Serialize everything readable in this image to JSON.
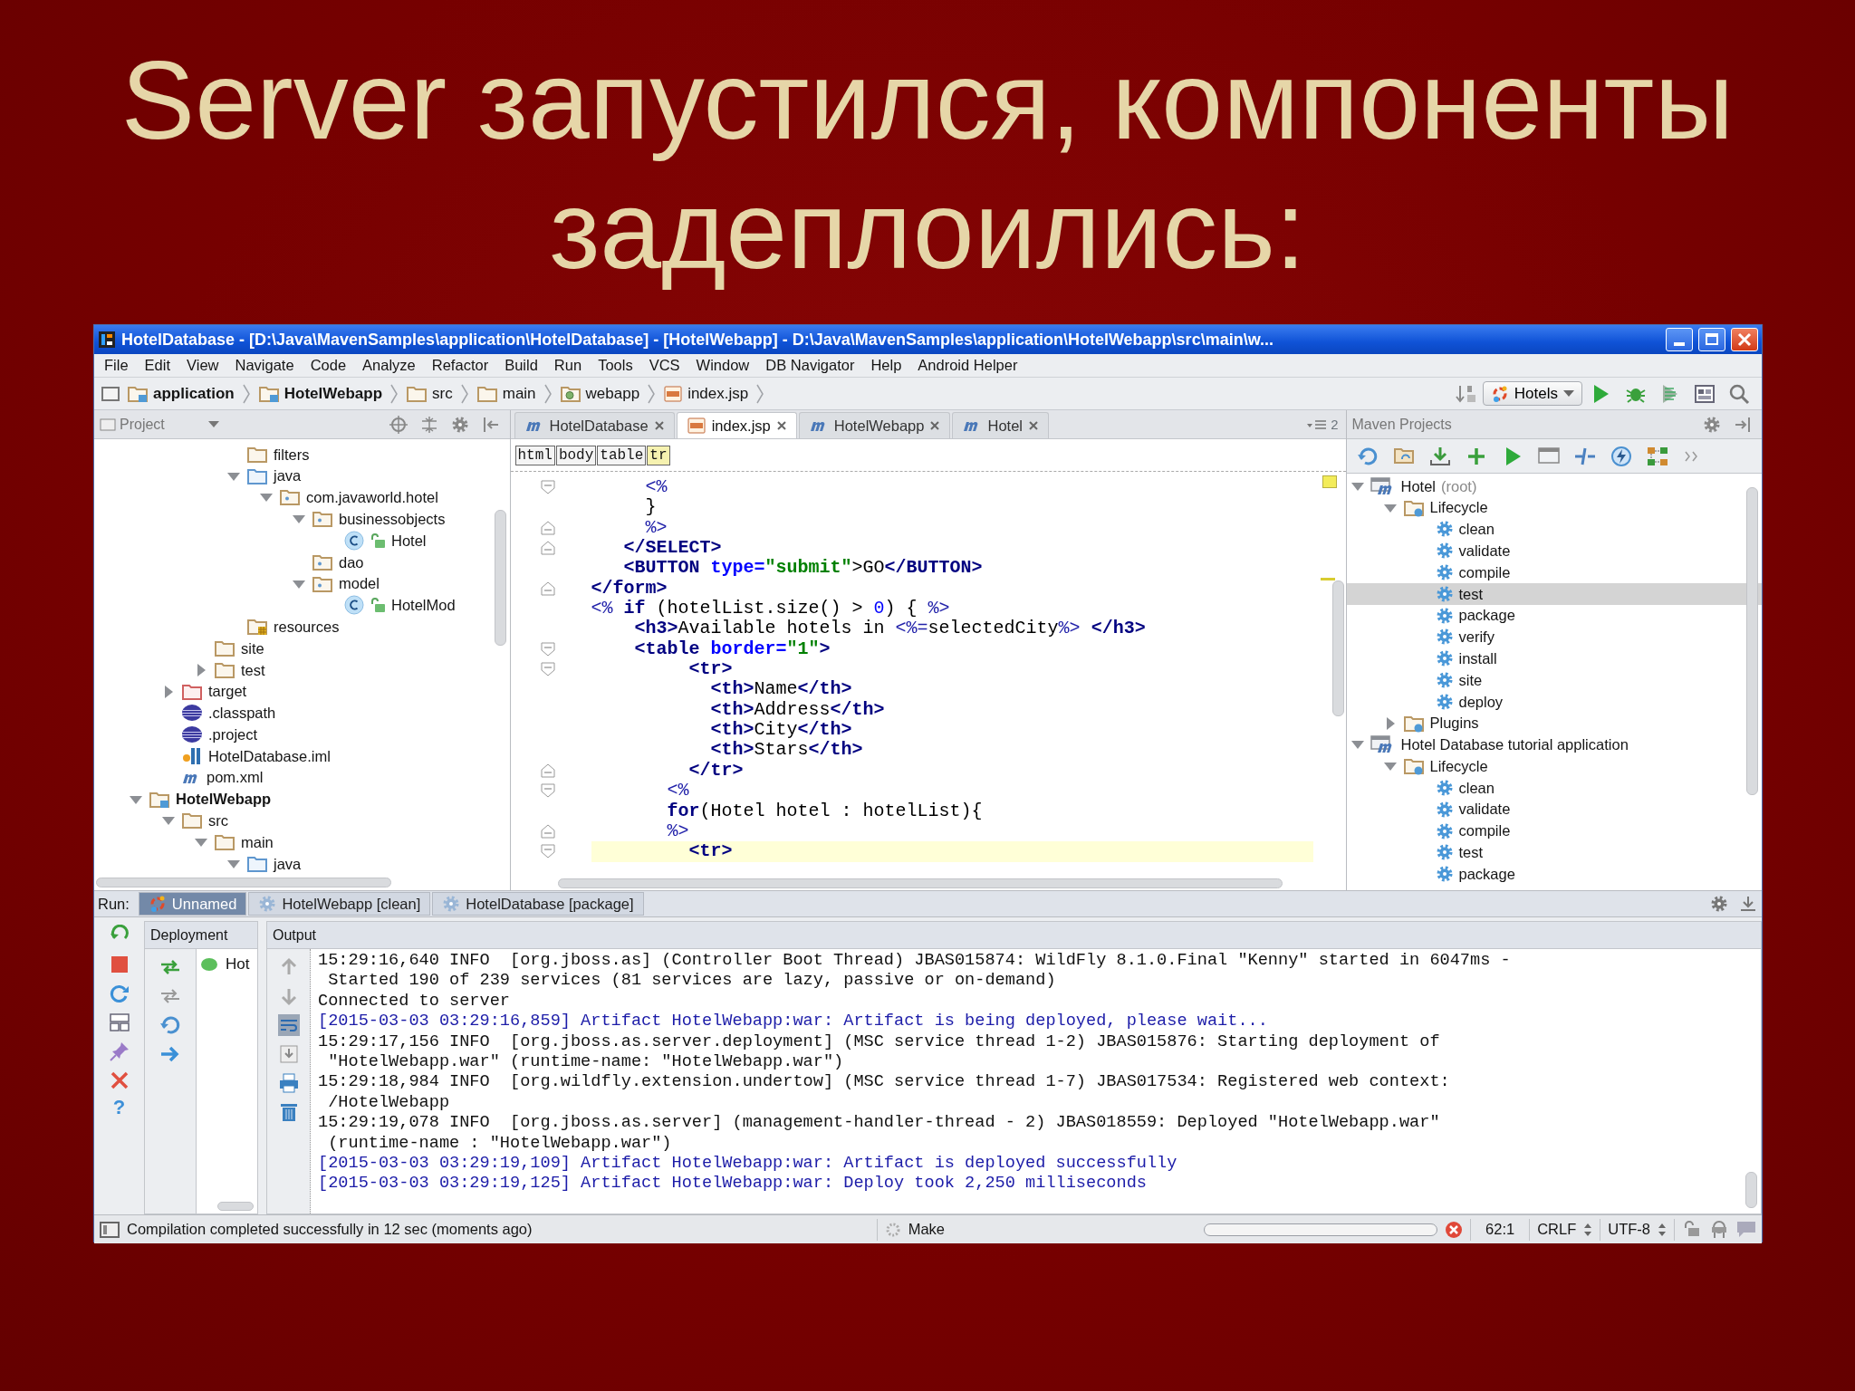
{
  "slide_title": "Server запустился, компоненты задеплоились:",
  "window": {
    "title": "HotelDatabase - [D:\\Java\\MavenSamples\\application\\HotelDatabase] - [HotelWebapp] - D:\\Java\\MavenSamples\\application\\HotelWebapp\\src\\main\\w..."
  },
  "menu": [
    "File",
    "Edit",
    "View",
    "Navigate",
    "Code",
    "Analyze",
    "Refactor",
    "Build",
    "Run",
    "Tools",
    "VCS",
    "Window",
    "DB Navigator",
    "Help",
    "Android Helper"
  ],
  "breadcrumbs": [
    {
      "label": "application",
      "kind": "module"
    },
    {
      "label": "HotelWebapp",
      "kind": "module"
    },
    {
      "label": "src",
      "kind": "folder"
    },
    {
      "label": "main",
      "kind": "folder"
    },
    {
      "label": "webapp",
      "kind": "web"
    },
    {
      "label": "index.jsp",
      "kind": "jsp"
    }
  ],
  "run_configuration": "Hotels",
  "project_panel": {
    "title": "Project",
    "tree": [
      {
        "children": [
          {
            "children": [
              {
                "children": [
                  {
                    "label": "filters",
                    "kind": "folder"
                  },
                  {
                    "label": "java",
                    "kind": "source",
                    "expanded": true,
                    "children": [
                      {
                        "label": "com.javaworld.hotel",
                        "kind": "package",
                        "expanded": true,
                        "children": [
                          {
                            "label": "businessobjects",
                            "kind": "package",
                            "expanded": true,
                            "children": [
                              {
                                "label": "Hotel",
                                "kind": "class"
                              }
                            ]
                          },
                          {
                            "label": "dao",
                            "kind": "package"
                          },
                          {
                            "label": "model",
                            "kind": "package",
                            "expanded": true,
                            "children": [
                              {
                                "label": "HotelMod",
                                "kind": "class"
                              }
                            ]
                          }
                        ]
                      }
                    ]
                  },
                  {
                    "label": "resources",
                    "kind": "resources"
                  }
                ]
              },
              {
                "label": "site",
                "kind": "folder"
              },
              {
                "label": "test",
                "kind": "folder",
                "expanded": false
              }
            ]
          },
          {
            "label": "target",
            "kind": "excluded",
            "expanded": false
          },
          {
            "label": ".classpath",
            "kind": "eclipse"
          },
          {
            "label": ".project",
            "kind": "eclipse"
          },
          {
            "label": "HotelDatabase.iml",
            "kind": "iml"
          },
          {
            "label": "pom.xml",
            "kind": "maven"
          }
        ]
      },
      {
        "label": "HotelWebapp",
        "kind": "module",
        "expanded": true,
        "children": [
          {
            "label": "src",
            "kind": "folder",
            "expanded": true,
            "children": [
              {
                "label": "main",
                "kind": "folder",
                "expanded": true,
                "children": [
                  {
                    "label": "java",
                    "kind": "source",
                    "expanded": true
                  }
                ]
              }
            ]
          }
        ]
      }
    ]
  },
  "editor": {
    "tabs": [
      {
        "label": "HotelDatabase",
        "kind": "maven",
        "selected": false
      },
      {
        "label": "index.jsp",
        "kind": "jsp",
        "selected": true
      },
      {
        "label": "HotelWebapp",
        "kind": "maven",
        "selected": false
      },
      {
        "label": "Hotel",
        "kind": "maven",
        "selected": false
      }
    ],
    "hidden_tab_count": "2",
    "tag_path": [
      {
        "label": "html",
        "selected": false
      },
      {
        "label": "body",
        "selected": false
      },
      {
        "label": "table",
        "selected": false
      },
      {
        "label": "tr",
        "selected": true
      }
    ],
    "lines": [
      {
        "kind": "fold_start",
        "current": false,
        "tokens": [
          {
            "text": "     <%",
            "kind": "jsp"
          }
        ]
      },
      {
        "kind": "plain",
        "current": false,
        "tokens": [
          {
            "text": "     }",
            "kind": "text"
          }
        ]
      },
      {
        "kind": "fold_end",
        "current": false,
        "tokens": [
          {
            "text": "     %>",
            "kind": "jsp"
          }
        ]
      },
      {
        "kind": "fold_end",
        "current": false,
        "tokens": [
          {
            "text": "   </SELECT>",
            "kind": "tag"
          }
        ]
      },
      {
        "kind": "plain",
        "current": false,
        "tokens": [
          {
            "text": "   <BUTTON",
            "kind": "tag"
          },
          {
            "text": " type=",
            "kind": "attr"
          },
          {
            "text": "\"submit\"",
            "kind": "str"
          },
          {
            "text": ">GO",
            "kind": "text"
          },
          {
            "text": "</BUTTON>",
            "kind": "tag"
          }
        ]
      },
      {
        "kind": "fold_end",
        "current": false,
        "tokens": [
          {
            "text": "</form>",
            "kind": "tag"
          }
        ]
      },
      {
        "kind": "plain",
        "current": false,
        "tokens": [
          {
            "text": "<%",
            "kind": "jsp"
          },
          {
            "text": " if",
            "kind": "kw"
          },
          {
            "text": " (hotelList.size() > ",
            "kind": "text"
          },
          {
            "text": "0",
            "kind": "num"
          },
          {
            "text": ") { ",
            "kind": "text"
          },
          {
            "text": "%>",
            "kind": "jsp"
          }
        ]
      },
      {
        "kind": "plain",
        "current": false,
        "tokens": [
          {
            "text": "    <h3>",
            "kind": "tag"
          },
          {
            "text": "Available hotels in ",
            "kind": "text"
          },
          {
            "text": "<%=",
            "kind": "jsp"
          },
          {
            "text": "selectedCity",
            "kind": "text"
          },
          {
            "text": "%>",
            "kind": "jsp"
          },
          {
            "text": " </h3>",
            "kind": "tag"
          }
        ]
      },
      {
        "kind": "fold_start",
        "current": false,
        "tokens": [
          {
            "text": "    <table",
            "kind": "tag"
          },
          {
            "text": " border=",
            "kind": "attr"
          },
          {
            "text": "\"1\"",
            "kind": "str"
          },
          {
            "text": ">",
            "kind": "tag"
          }
        ]
      },
      {
        "kind": "fold_start",
        "current": false,
        "tokens": [
          {
            "text": "         <tr>",
            "kind": "tag"
          }
        ]
      },
      {
        "kind": "plain",
        "current": false,
        "tokens": [
          {
            "text": "           <th>",
            "kind": "tag"
          },
          {
            "text": "Name",
            "kind": "text"
          },
          {
            "text": "</th>",
            "kind": "tag"
          }
        ]
      },
      {
        "kind": "plain",
        "current": false,
        "tokens": [
          {
            "text": "           <th>",
            "kind": "tag"
          },
          {
            "text": "Address",
            "kind": "text"
          },
          {
            "text": "</th>",
            "kind": "tag"
          }
        ]
      },
      {
        "kind": "plain",
        "current": false,
        "tokens": [
          {
            "text": "           <th>",
            "kind": "tag"
          },
          {
            "text": "City",
            "kind": "text"
          },
          {
            "text": "</th>",
            "kind": "tag"
          }
        ]
      },
      {
        "kind": "plain",
        "current": false,
        "tokens": [
          {
            "text": "           <th>",
            "kind": "tag"
          },
          {
            "text": "Stars",
            "kind": "text"
          },
          {
            "text": "</th>",
            "kind": "tag"
          }
        ]
      },
      {
        "kind": "fold_end",
        "current": false,
        "tokens": [
          {
            "text": "         </tr>",
            "kind": "tag"
          }
        ]
      },
      {
        "kind": "fold_start",
        "current": false,
        "tokens": [
          {
            "text": "       <%",
            "kind": "jsp"
          }
        ]
      },
      {
        "kind": "plain",
        "current": false,
        "tokens": [
          {
            "text": "       for",
            "kind": "kw"
          },
          {
            "text": "(Hotel hotel : hotelList){",
            "kind": "text"
          }
        ]
      },
      {
        "kind": "fold_end",
        "current": false,
        "tokens": [
          {
            "text": "       %>",
            "kind": "jsp"
          }
        ]
      },
      {
        "kind": "fold_start",
        "current": true,
        "tokens": [
          {
            "text": "         <tr>",
            "kind": "tag"
          }
        ]
      }
    ]
  },
  "maven_panel": {
    "title": "Maven Projects",
    "tree": [
      {
        "label": "Hotel",
        "note": "(root)",
        "kind": "project",
        "expanded": true,
        "selected": false,
        "children": [
          {
            "label": "Lifecycle",
            "kind": "lifecycle",
            "expanded": true,
            "selected": false,
            "children": [
              {
                "label": "clean",
                "kind": "goal",
                "selected": false
              },
              {
                "label": "validate",
                "kind": "goal",
                "selected": false
              },
              {
                "label": "compile",
                "kind": "goal",
                "selected": false
              },
              {
                "label": "test",
                "kind": "goal",
                "selected": true
              },
              {
                "label": "package",
                "kind": "goal",
                "selected": false
              },
              {
                "label": "verify",
                "kind": "goal",
                "selected": false
              },
              {
                "label": "install",
                "kind": "goal",
                "selected": false
              },
              {
                "label": "site",
                "kind": "goal",
                "selected": false
              },
              {
                "label": "deploy",
                "kind": "goal",
                "selected": false
              }
            ]
          },
          {
            "label": "Plugins",
            "kind": "lifecycle",
            "expanded": false,
            "selected": false
          }
        ]
      },
      {
        "label": "Hotel Database tutorial application",
        "kind": "project",
        "expanded": true,
        "selected": false,
        "children": [
          {
            "label": "Lifecycle",
            "kind": "lifecycle",
            "expanded": true,
            "selected": false,
            "children": [
              {
                "label": "clean",
                "kind": "goal",
                "selected": false
              },
              {
                "label": "validate",
                "kind": "goal",
                "selected": false
              },
              {
                "label": "compile",
                "kind": "goal",
                "selected": false
              },
              {
                "label": "test",
                "kind": "goal",
                "selected": false
              },
              {
                "label": "package",
                "kind": "goal",
                "selected": false
              }
            ]
          }
        ]
      }
    ]
  },
  "run_panel": {
    "label": "Run:",
    "tabs": [
      {
        "label": "Unnamed",
        "selected": true
      },
      {
        "label": "HotelWebapp [clean]",
        "selected": false
      },
      {
        "label": "HotelDatabase [package]",
        "selected": false
      }
    ],
    "help_glyph": "?",
    "deployment": {
      "title": "Deployment",
      "items": [
        {
          "label": "Hot"
        }
      ]
    },
    "output": {
      "title": "Output",
      "lines": [
        {
          "kind": "info",
          "text": "15:29:16,640 INFO  [org.jboss.as] (Controller Boot Thread) JBAS015874: WildFly 8.1.0.Final \"Kenny\" started in 6047ms -"
        },
        {
          "kind": "info",
          "text": " Started 190 of 239 services (81 services are lazy, passive or on-demand)"
        },
        {
          "kind": "info",
          "text": "Connected to server"
        },
        {
          "kind": "artifact",
          "text": "[2015-03-03 03:29:16,859] Artifact HotelWebapp:war: Artifact is being deployed, please wait..."
        },
        {
          "kind": "info",
          "text": "15:29:17,156 INFO  [org.jboss.as.server.deployment] (MSC service thread 1-2) JBAS015876: Starting deployment of"
        },
        {
          "kind": "info",
          "text": " \"HotelWebapp.war\" (runtime-name: \"HotelWebapp.war\")"
        },
        {
          "kind": "info",
          "text": "15:29:18,984 INFO  [org.wildfly.extension.undertow] (MSC service thread 1-7) JBAS017534: Registered web context:"
        },
        {
          "kind": "info",
          "text": " /HotelWebapp"
        },
        {
          "kind": "info",
          "text": "15:29:19,078 INFO  [org.jboss.as.server] (management-handler-thread - 2) JBAS018559: Deployed \"HotelWebapp.war\""
        },
        {
          "kind": "info",
          "text": " (runtime-name : \"HotelWebapp.war\")"
        },
        {
          "kind": "artifact",
          "text": "[2015-03-03 03:29:19,109] Artifact HotelWebapp:war: Artifact is deployed successfully"
        },
        {
          "kind": "artifact",
          "text": "[2015-03-03 03:29:19,125] Artifact HotelWebapp:war: Deploy took 2,250 milliseconds"
        }
      ]
    }
  },
  "status_bar": {
    "message": "Compilation completed successfully in 12 sec (moments ago)",
    "task": "Make",
    "progress": {
      "level": 0
    },
    "position": "62:1",
    "line_separator": "CRLF",
    "encoding": "UTF-8"
  }
}
